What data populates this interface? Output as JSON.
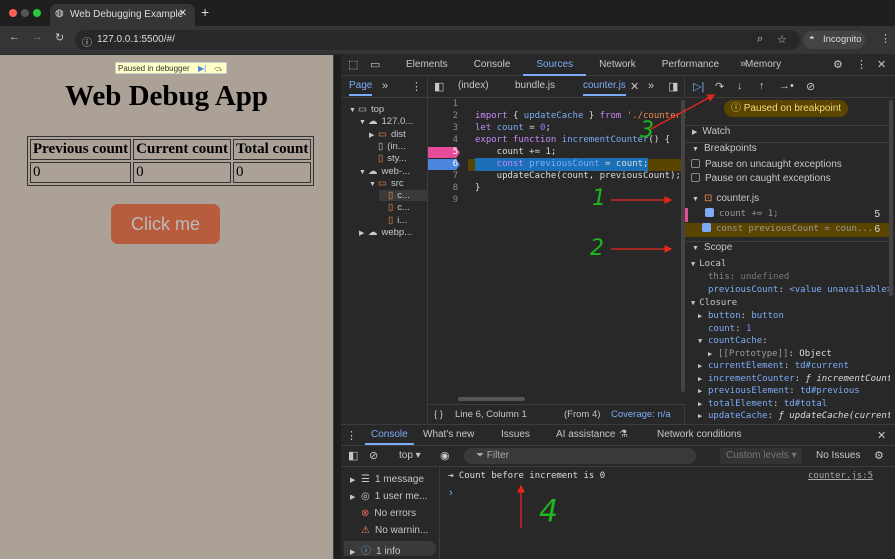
{
  "browser": {
    "tab_title": "Web Debugging Example",
    "url": "127.0.0.1:5500/#/",
    "incognito_label": "Incognito"
  },
  "page": {
    "paused_label": "Paused in debugger",
    "title": "Web Debug App",
    "table": {
      "headers": [
        "Previous count",
        "Current count",
        "Total count"
      ],
      "row": [
        "0",
        "0",
        "0"
      ]
    },
    "button_label": "Click me"
  },
  "devtools": {
    "tabs": [
      "Elements",
      "Console",
      "Sources",
      "Network",
      "Performance",
      "Memory"
    ],
    "active_tab": "Sources",
    "navigator": {
      "tab": "Page",
      "tree": [
        {
          "label": "top",
          "depth": 0
        },
        {
          "label": "127.0...",
          "depth": 1
        },
        {
          "label": "dist",
          "depth": 2
        },
        {
          "label": "(in...",
          "depth": 2
        },
        {
          "label": "sty...",
          "depth": 2
        },
        {
          "label": "web-...",
          "depth": 1
        },
        {
          "label": "src",
          "depth": 2
        },
        {
          "label": "c...",
          "depth": 3
        },
        {
          "label": "c...",
          "depth": 3
        },
        {
          "label": "i...",
          "depth": 3
        },
        {
          "label": "webp...",
          "depth": 1
        }
      ]
    },
    "editor": {
      "tabs": [
        "(index)",
        "bundle.js",
        "counter.js"
      ],
      "active_tab": "counter.js",
      "lines": [
        [],
        [
          [
            "kw",
            "import "
          ],
          [
            "",
            "{ "
          ],
          [
            "fn",
            "updateCache"
          ],
          [
            "",
            " } "
          ],
          [
            "kw",
            "from "
          ],
          [
            "str",
            "'./counterC"
          ]
        ],
        [
          [
            "kw",
            "let "
          ],
          [
            "fn",
            "count"
          ],
          [
            "",
            " = "
          ],
          [
            "num",
            "0"
          ],
          [
            "",
            ";"
          ]
        ],
        [
          [
            "kw",
            "export function "
          ],
          [
            "fn",
            "incrementCounter"
          ],
          [
            "",
            "() {"
          ]
        ],
        [
          [
            "",
            "    count += 1;"
          ]
        ],
        [
          [
            "kw",
            "    const "
          ],
          [
            "fn",
            "previousCount"
          ],
          [
            "",
            " = count;"
          ]
        ],
        [
          [
            "",
            "    updateCache(count, previousCount);"
          ]
        ],
        [
          [
            "",
            "}"
          ]
        ],
        []
      ],
      "breakpoint_lines": [
        "5",
        "6"
      ],
      "current_line": "6",
      "status": {
        "position": "Line 6, Column 1",
        "from": "(From 4)",
        "coverage": "Coverage: n/a"
      }
    },
    "debugger": {
      "paused_message": "Paused on breakpoint",
      "watch": "Watch",
      "breakpoints": "Breakpoints",
      "pause_uncaught": "Pause on uncaught exceptions",
      "pause_caught": "Pause on caught exceptions",
      "bp_file": "counter.js",
      "bp_items": [
        {
          "code": "count += 1;",
          "line": "5"
        },
        {
          "code": "const previousCount = coun...",
          "line": "6"
        }
      ],
      "scope": "Scope",
      "local": "Local",
      "local_vars": [
        {
          "name": "this",
          "value": "undefined"
        },
        {
          "name": "previousCount",
          "value": "<value unavailable>"
        }
      ],
      "closure": "Closure",
      "closure_vars": [
        {
          "name": "button",
          "value": "button",
          "arrow": "▶"
        },
        {
          "name": "count",
          "value": "1",
          "arrow": ""
        },
        {
          "name": "countCache",
          "value": "",
          "arrow": "▼"
        },
        {
          "name": "[[Prototype]]",
          "value": "Object",
          "arrow": "▶",
          "indent": true
        },
        {
          "name": "currentElement",
          "value": "td#current",
          "arrow": "▶"
        },
        {
          "name": "incrementCounter",
          "value": "ƒ incrementCounte",
          "arrow": "▶"
        },
        {
          "name": "previousElement",
          "value": "td#previous",
          "arrow": "▶"
        },
        {
          "name": "totalElement",
          "value": "td#total",
          "arrow": "▶"
        },
        {
          "name": "updateCache",
          "value": "ƒ updateCache(currentC",
          "arrow": "▶"
        }
      ]
    },
    "drawer": {
      "tabs": [
        "Console",
        "What's new",
        "Issues",
        "AI assistance",
        "Network conditions"
      ],
      "active_tab": "Console",
      "context": "top",
      "filter_placeholder": "Filter",
      "levels": "Custom levels",
      "issues": "No Issues",
      "sidebar": [
        "1 message",
        "1 user me...",
        "No errors",
        "No warnin...",
        "1 info"
      ],
      "message": "Count before increment is 0",
      "source": "counter.js:5",
      "prompt": "›"
    }
  },
  "annotations": [
    "1",
    "2",
    "3",
    "4"
  ],
  "colors": {
    "accent": "#7cacf8",
    "breakpoint": "#e74c9b",
    "current_line": "#4a85e0",
    "paused_bg": "#5a4500",
    "button": "#b85c3e"
  }
}
